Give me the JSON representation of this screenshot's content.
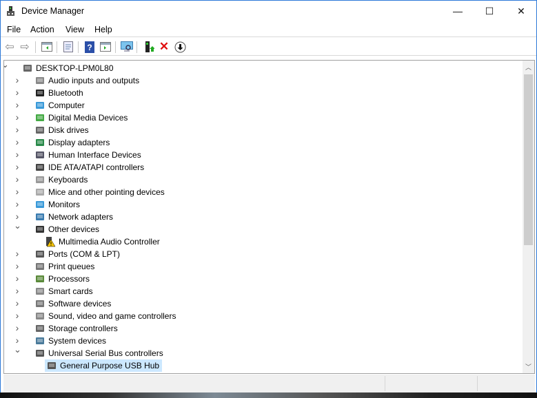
{
  "window": {
    "title": "Device Manager",
    "minimize": "—",
    "maximize": "☐",
    "close": "✕"
  },
  "menu": [
    "File",
    "Action",
    "View",
    "Help"
  ],
  "toolbar": [
    "back",
    "forward",
    "show-hide-console-tree",
    "properties",
    "help",
    "action-pane",
    "scan-hardware",
    "update-driver",
    "uninstall",
    "disable"
  ],
  "tree": {
    "root": "DESKTOP-LPM0L80",
    "items": [
      {
        "label": "Audio inputs and outputs",
        "icon": "speaker-icon",
        "expanded": false
      },
      {
        "label": "Bluetooth",
        "icon": "bluetooth-icon",
        "expanded": false
      },
      {
        "label": "Computer",
        "icon": "computer-icon",
        "expanded": false
      },
      {
        "label": "Digital Media Devices",
        "icon": "media-icon",
        "expanded": false
      },
      {
        "label": "Disk drives",
        "icon": "disk-icon",
        "expanded": false
      },
      {
        "label": "Display adapters",
        "icon": "display-adapter-icon",
        "expanded": false
      },
      {
        "label": "Human Interface Devices",
        "icon": "hid-icon",
        "expanded": false
      },
      {
        "label": "IDE ATA/ATAPI controllers",
        "icon": "ide-icon",
        "expanded": false
      },
      {
        "label": "Keyboards",
        "icon": "keyboard-icon",
        "expanded": false
      },
      {
        "label": "Mice and other pointing devices",
        "icon": "mouse-icon",
        "expanded": false
      },
      {
        "label": "Monitors",
        "icon": "monitor-icon",
        "expanded": false
      },
      {
        "label": "Network adapters",
        "icon": "network-icon",
        "expanded": false
      },
      {
        "label": "Other devices",
        "icon": "other-devices-icon",
        "expanded": true,
        "children": [
          {
            "label": "Multimedia Audio Controller",
            "icon": "warning-device-icon"
          }
        ]
      },
      {
        "label": "Ports (COM & LPT)",
        "icon": "port-icon",
        "expanded": false
      },
      {
        "label": "Print queues",
        "icon": "printer-icon",
        "expanded": false
      },
      {
        "label": "Processors",
        "icon": "processor-icon",
        "expanded": false
      },
      {
        "label": "Smart cards",
        "icon": "smart-card-icon",
        "expanded": false
      },
      {
        "label": "Software devices",
        "icon": "software-device-icon",
        "expanded": false
      },
      {
        "label": "Sound, video and game controllers",
        "icon": "sound-icon",
        "expanded": false
      },
      {
        "label": "Storage controllers",
        "icon": "storage-icon",
        "expanded": false
      },
      {
        "label": "System devices",
        "icon": "system-icon",
        "expanded": false
      },
      {
        "label": "Universal Serial Bus controllers",
        "icon": "usb-icon",
        "expanded": true,
        "children": [
          {
            "label": "General Purpose USB Hub",
            "icon": "usb-icon",
            "selected": true
          }
        ]
      }
    ]
  },
  "colors": {
    "selection": "#cce8ff",
    "accent": "#2b78d8"
  }
}
